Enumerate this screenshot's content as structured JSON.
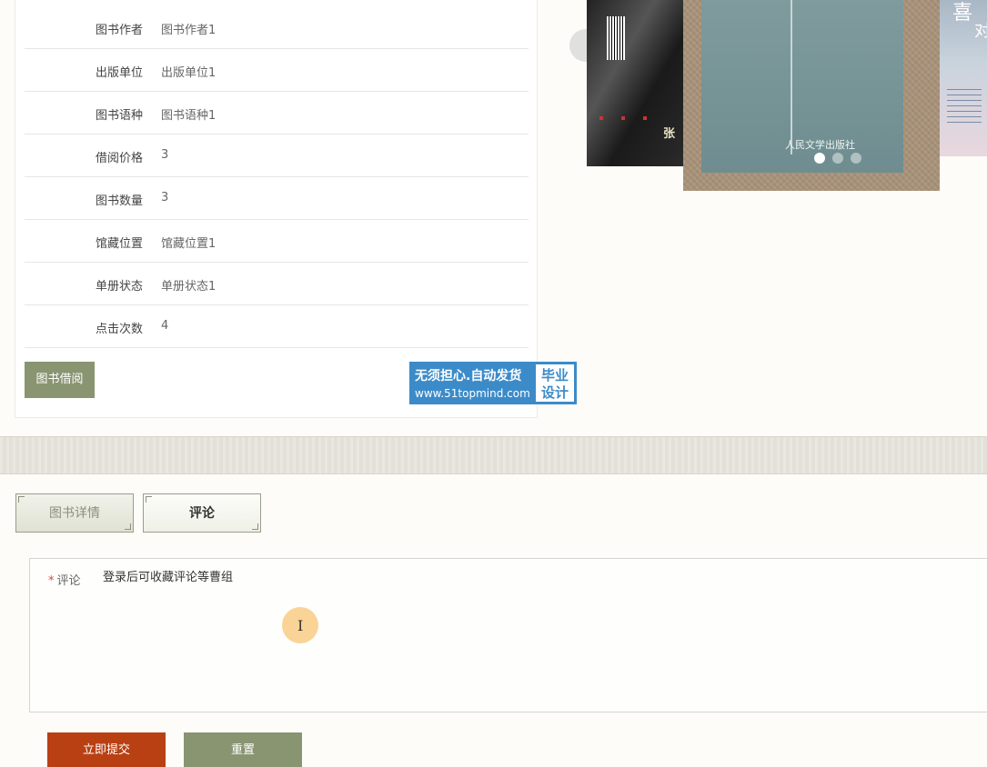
{
  "info": {
    "rows": [
      {
        "label": "图书作者",
        "value": "图书作者1"
      },
      {
        "label": "出版单位",
        "value": "出版单位1"
      },
      {
        "label": "图书语种",
        "value": "图书语种1"
      },
      {
        "label": "借阅价格",
        "value": "3"
      },
      {
        "label": "图书数量",
        "value": "3"
      },
      {
        "label": "馆藏位置",
        "value": "馆藏位置1"
      },
      {
        "label": "单册状态",
        "value": "单册状态1"
      },
      {
        "label": "点击次数",
        "value": "4"
      }
    ],
    "borrow_label": "图书借阅"
  },
  "watermark": {
    "line1": "无须担心.自动发货",
    "line2": "www.51topmind.com",
    "right1": "毕业",
    "right2": "设计"
  },
  "carousel": {
    "left_book_text": "张",
    "center_book_publisher": "人民文学出版社",
    "right_book_title": "喜",
    "right_book_title2": "对",
    "active_slide": 1,
    "slide_count": 3
  },
  "tabs": {
    "detail": "图书详情",
    "comment": "评论"
  },
  "form": {
    "label": "评论",
    "required_mark": "*",
    "value": "登录后可收藏评论等曹组",
    "submit": "立即提交",
    "reset": "重置"
  },
  "colors": {
    "accent_green": "#899471",
    "submit_red": "#b94013",
    "watermark_blue": "#3c8bc9"
  }
}
